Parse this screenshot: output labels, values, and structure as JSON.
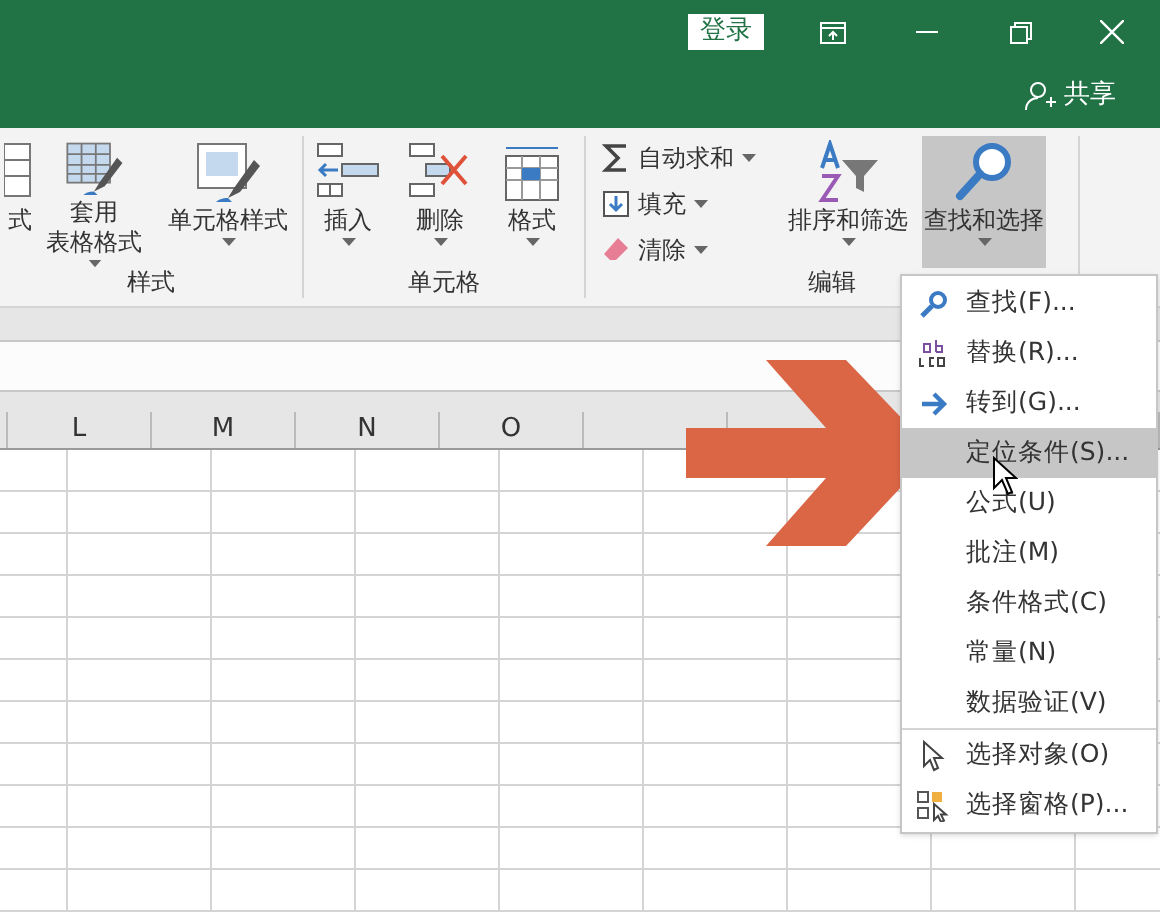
{
  "title_bar": {
    "sign_in": "登录",
    "share": "共享"
  },
  "ribbon": {
    "groups": [
      {
        "label": "样式",
        "buttons": [
          {
            "label": "式",
            "dropdown": false
          },
          {
            "label_lines": [
              "套用",
              "表格格式"
            ],
            "dropdown": true
          },
          {
            "label": "单元格样式",
            "dropdown": true
          }
        ]
      },
      {
        "label": "单元格",
        "buttons": [
          {
            "label": "插入",
            "dropdown": true
          },
          {
            "label": "删除",
            "dropdown": true
          },
          {
            "label": "格式",
            "dropdown": true
          }
        ]
      },
      {
        "label": "编辑",
        "small_buttons": [
          {
            "label": "自动求和",
            "dropdown": true
          },
          {
            "label": "填充",
            "dropdown": true
          },
          {
            "label": "清除",
            "dropdown": true
          }
        ],
        "buttons": [
          {
            "label": "排序和筛选",
            "dropdown": true,
            "selected": false
          },
          {
            "label": "查找和选择",
            "dropdown": true,
            "selected": true
          }
        ]
      }
    ]
  },
  "sheet": {
    "columns": [
      "L",
      "M",
      "N",
      "O"
    ]
  },
  "menu": {
    "sections": [
      [
        {
          "label": "查找(F)...",
          "selected": false
        },
        {
          "label": "替换(R)...",
          "selected": false
        },
        {
          "label": "转到(G)...",
          "selected": false
        },
        {
          "label": "定位条件(S)...",
          "selected": true
        },
        {
          "label": "公式(U)",
          "selected": false
        },
        {
          "label": "批注(M)",
          "selected": false
        },
        {
          "label": "条件格式(C)",
          "selected": false
        },
        {
          "label": "常量(N)",
          "selected": false
        },
        {
          "label": "数据验证(V)",
          "selected": false
        }
      ],
      [
        {
          "label": "选择对象(O)",
          "selected": false
        },
        {
          "label": "选择窗格(P)...",
          "selected": false
        }
      ]
    ]
  }
}
